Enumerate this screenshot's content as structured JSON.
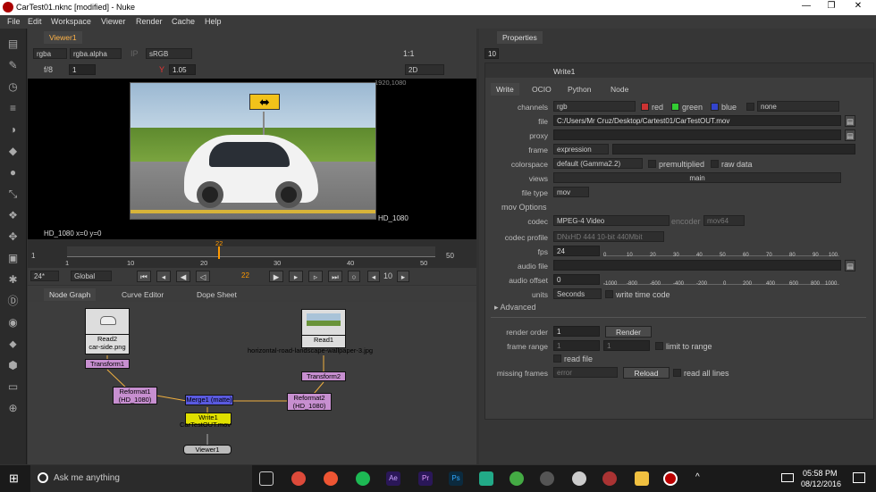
{
  "window": {
    "title": "CarTest01.nknc [modified] - Nuke",
    "controls": [
      "—",
      "❐",
      "✕"
    ]
  },
  "menu": [
    "File",
    "Edit",
    "Workspace",
    "Viewer",
    "Render",
    "Cache",
    "Help"
  ],
  "viewer": {
    "tab": "Viewer1",
    "channels": "rgba",
    "layer": "rgba.alpha",
    "ip": "IP",
    "colorspace": "sRGB",
    "fstop": "f/8",
    "frame_step": "1",
    "gamma_label": "Y",
    "gamma": "1.05",
    "mode": "2D",
    "zoom": "1:1",
    "format_top": "1920,1080",
    "format_bottom": "HD_1080",
    "status": "HD_1080  x=0 y=0",
    "sign_arrow": "⬌"
  },
  "timeline": {
    "start": "1",
    "end": "50",
    "current": "22",
    "ticks": [
      "1",
      "10",
      "20",
      "30",
      "40",
      "50"
    ],
    "fps": "24*",
    "mode": "Global",
    "frame_field": "22",
    "inc": "10"
  },
  "nodegraph": {
    "tabs": [
      "Node Graph",
      "Curve Editor",
      "Dope Sheet"
    ],
    "nodes": {
      "read2": "Read2",
      "read2_file": "car-side.png",
      "read1": "Read1",
      "read1_file": "horizontal-road-landscape-wallpaper-3.jpg",
      "transform1": "Transform1",
      "transform2": "Transform2",
      "reformat1": "Reformat1",
      "reformat1_sub": "(HD_1080)",
      "reformat2": "Reformat2",
      "reformat2_sub": "(HD_1080)",
      "merge": "Merge1 (matte)",
      "write1": "Write1",
      "write1_file": "CarTestOUT.mov",
      "viewer1": "Viewer1"
    }
  },
  "properties": {
    "tab": "Properties",
    "count": "10",
    "node_name": "Write1",
    "subtabs": [
      "Write",
      "OCIO",
      "Python",
      "Node"
    ],
    "channels_label": "channels",
    "channels": "rgb",
    "ch_red": "red",
    "ch_green": "green",
    "ch_blue": "blue",
    "ch_none": "none",
    "file_label": "file",
    "file": "C:/Users/Mr Cruz/Desktop/Cartest01/CarTestOUT.mov",
    "proxy_label": "proxy",
    "frame_label": "frame",
    "frame": "expression",
    "colorspace_label": "colorspace",
    "colorspace": "default (Gamma2.2)",
    "premultiplied": "premultiplied",
    "raw": "raw data",
    "views_label": "views",
    "views": "main",
    "filetype_label": "file type",
    "filetype": "mov",
    "mov_options": "mov Options",
    "codec_label": "codec",
    "codec": "MPEG-4 Video",
    "encoder_label": "encoder",
    "encoder": "mov64",
    "profile_label": "codec profile",
    "profile": "DNxHD 444 10-bit 440Mbit",
    "fps_label": "fps",
    "fps": "24",
    "fps_ticks": [
      "0",
      "10",
      "20",
      "30",
      "40",
      "50",
      "60",
      "70",
      "80",
      "90",
      "100"
    ],
    "audio_label": "audio file",
    "offset_label": "audio offset",
    "offset": "0",
    "offset_ticks": [
      "-1000",
      "-800",
      "-600",
      "-400",
      "-200",
      "0",
      "200",
      "400",
      "600",
      "800",
      "1000"
    ],
    "units_label": "units",
    "units": "Seconds",
    "write_tc": "write time code",
    "advanced": "Advanced",
    "render_order_label": "render order",
    "render_order": "1",
    "render_btn": "Render",
    "frame_range_label": "frame range",
    "fr_start": "1",
    "fr_end": "1",
    "limit": "limit to range",
    "read_file": "read file",
    "missing_label": "missing frames",
    "missing": "error",
    "reload": "Reload",
    "read_all": "read all lines"
  },
  "taskbar": {
    "search": "Ask me anything",
    "time": "05:58 PM",
    "date": "08/12/2016"
  }
}
